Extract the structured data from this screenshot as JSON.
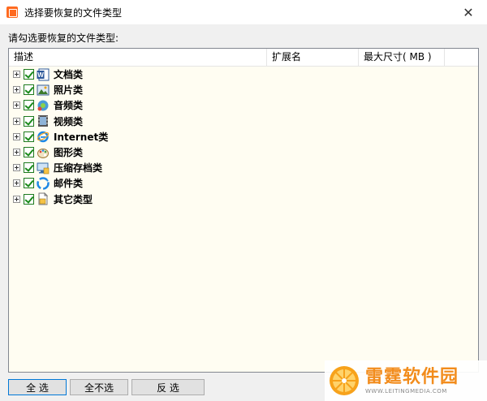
{
  "window": {
    "title": "选择要恢复的文件类型",
    "close_glyph": "✕"
  },
  "prompt": "请勾选要恢复的文件类型:",
  "table": {
    "columns": [
      "描述",
      "扩展名",
      "最大尺寸( MB )"
    ],
    "rows": [
      {
        "label": "文档类",
        "icon": "word-document-icon",
        "checked": true
      },
      {
        "label": "照片类",
        "icon": "photo-icon",
        "checked": true
      },
      {
        "label": "音频类",
        "icon": "audio-icon",
        "checked": true
      },
      {
        "label": "视频类",
        "icon": "video-icon",
        "checked": true
      },
      {
        "label": "Internet类",
        "icon": "internet-explorer-icon",
        "checked": true
      },
      {
        "label": "图形类",
        "icon": "graphics-icon",
        "checked": true
      },
      {
        "label": "压缩存档类",
        "icon": "archive-icon",
        "checked": true
      },
      {
        "label": "邮件类",
        "icon": "mail-icon",
        "checked": true
      },
      {
        "label": "其它类型",
        "icon": "other-file-icon",
        "checked": true
      }
    ]
  },
  "buttons": {
    "select_all": "全 选",
    "select_none": "全不选",
    "invert": "反 选"
  },
  "watermark": {
    "name": "雷霆软件园",
    "url": "WWW.LEITINGMEDIA.COM"
  },
  "colors": {
    "accent": "#0078d7",
    "check": "#1a8a1a",
    "list_bg": "#fffdf2",
    "brand": "#f28c1c"
  }
}
